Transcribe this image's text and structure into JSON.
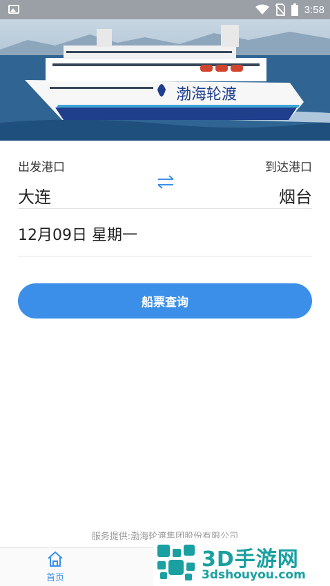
{
  "status_bar": {
    "time": "3:58"
  },
  "hero": {
    "ship_name": "渤海轮渡"
  },
  "search": {
    "from_label": "出发港口",
    "to_label": "到达港口",
    "from_city": "大连",
    "to_city": "烟台",
    "date": "12月09日  星期一",
    "query_button": "船票查询"
  },
  "footer": {
    "provider": "服务提供:渤海轮渡集团股份有限公司"
  },
  "tabbar": {
    "items": [
      {
        "label": "首页",
        "icon": "home-icon",
        "active": true
      }
    ]
  },
  "watermark": {
    "title": "3D手游网",
    "url": "3dshouyou.com"
  },
  "colors": {
    "accent": "#3b8fe8",
    "watermark": "#1aa0a0",
    "status_bar": "#9aa0a6"
  }
}
